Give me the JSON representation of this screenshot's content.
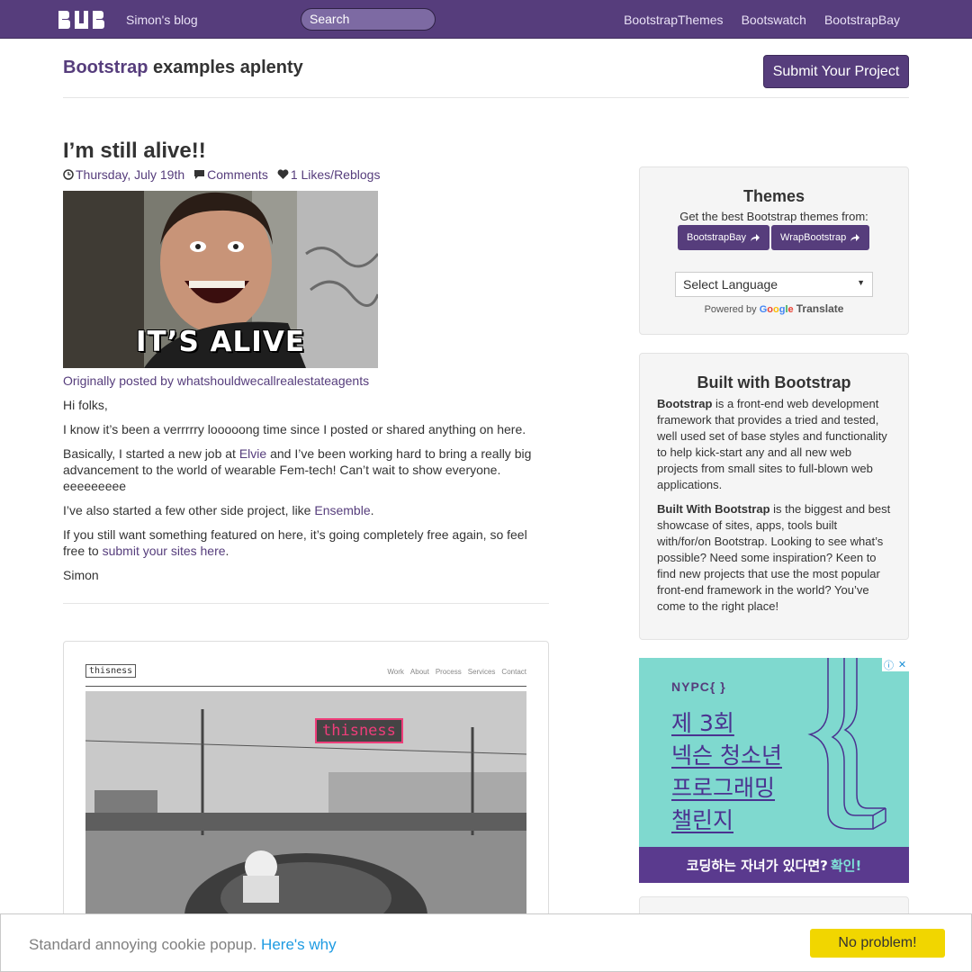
{
  "nav": {
    "logo": "BUB",
    "blog_link": "Simon's blog",
    "search_placeholder": "Search",
    "right_links": [
      "BootstrapThemes",
      "Bootswatch",
      "BootstrapBay"
    ]
  },
  "header": {
    "title_brand": "Bootstrap",
    "title_rest": " examples aplenty",
    "submit_label": "Submit Your Project"
  },
  "post": {
    "title": "I’m still alive!!",
    "date": "Thursday, July 19th",
    "comments": "Comments",
    "likes": "1 Likes/Reblogs",
    "image_caption": "IT’S ALIVE",
    "original_link": "Originally posted by whatshouldwecallrealestateagents",
    "greeting": "Hi folks,",
    "p1": "I know it’s been a verrrrry looooong time since I posted or shared anything on here.",
    "p2_before": "Basically, I started a new job at ",
    "p2_link": "Elvie",
    "p2_after": " and I’ve been working hard to bring a really big advancement to the world of wearable Fem-tech! Can’t wait to show everyone. eeeeeeeee",
    "p3_before": "I’ve also started a few other side project, like ",
    "p3_link": "Ensemble",
    "p3_after": ".",
    "p4_before": "If you still want something featured on here, it’s going completely free again, so feel free to ",
    "p4_link": "submit your sites here",
    "p4_after": ".",
    "signoff": "Simon"
  },
  "card2": {
    "logo": "thisness",
    "nav": [
      "Work",
      "About",
      "Process",
      "Services",
      "Contact"
    ],
    "sign": "thisness"
  },
  "sidebar": {
    "themes": {
      "title": "Themes",
      "desc": "Get the best Bootstrap themes from:",
      "buttons": [
        "BootstrapBay",
        "WrapBootstrap"
      ],
      "language_select": "Select Language",
      "powered_by": "Powered by",
      "google": "Google",
      "translate": "Translate"
    },
    "built": {
      "title": "Built with Bootstrap",
      "p1_bold": "Bootstrap",
      "p1_rest": " is a front-end web development framework that provides a tried and tested, well used set of base styles and functionality to help kick-start any and all new web projects from small sites to full-blown web applications.",
      "p2_bold": "Built With Bootstrap",
      "p2_rest": " is the biggest and best showcase of sites, apps, tools built with/for/on Bootstrap. Looking to see what’s possible? Need some inspiration? Keen to find new projects that use the most popular front-end framework in the world? You’ve come to the right place!"
    },
    "ad": {
      "brand": "NYPC{ }",
      "lines": [
        "제 3회",
        "넥슨 청소년",
        "프로그래밍",
        "챌린지"
      ],
      "footer_text": "코딩하는 자녀가 있다면?",
      "footer_cta": "확인!"
    }
  },
  "cookie": {
    "text": "Standard annoying cookie popup.",
    "link": "Here's why",
    "button": "No problem!"
  },
  "colors": {
    "brand": "#563d7c",
    "cookie_button": "#f1d600",
    "cookie_link": "#1e9be2",
    "ad_background": "#7fd9cf"
  }
}
